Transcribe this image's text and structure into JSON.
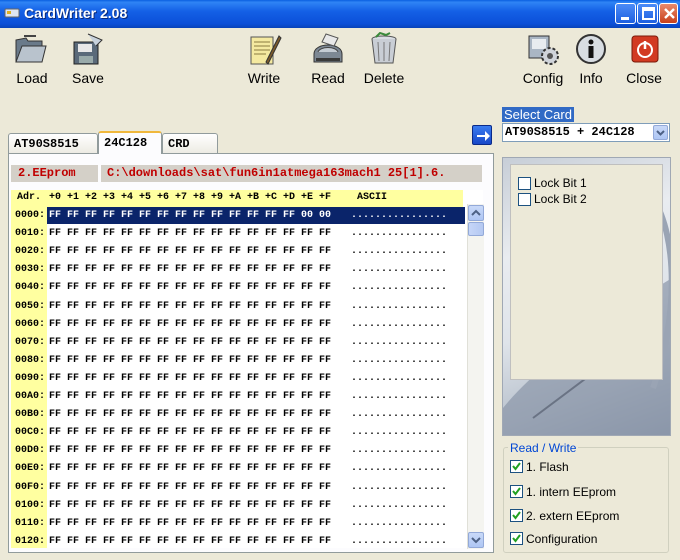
{
  "window": {
    "title": "CardWriter 2.08"
  },
  "toolbar": {
    "load": "Load",
    "save": "Save",
    "write": "Write",
    "read": "Read",
    "delete": "Delete",
    "config": "Config",
    "info": "Info",
    "close": "Close"
  },
  "tabs": [
    {
      "label": "AT90S8515"
    },
    {
      "label": "24C128"
    },
    {
      "label": "CRD"
    }
  ],
  "editor": {
    "section_label": "2.EEprom",
    "file_path": "C:\\downloads\\sat\\fun6in1atmega163mach1 25[1].6.",
    "header_addr": "Adr.",
    "header_cols": "+0 +1 +2 +3 +4 +5 +6 +7 +8 +9 +A +B +C +D +E +F",
    "header_ascii": "ASCII",
    "rows": [
      {
        "addr": "0000:",
        "bytes": "FF FF FF FF FF FF FF FF FF FF FF FF FF FF 00 00",
        "ascii": "................"
      },
      {
        "addr": "0010:",
        "bytes": "FF FF FF FF FF FF FF FF FF FF FF FF FF FF FF FF",
        "ascii": "................"
      },
      {
        "addr": "0020:",
        "bytes": "FF FF FF FF FF FF FF FF FF FF FF FF FF FF FF FF",
        "ascii": "................"
      },
      {
        "addr": "0030:",
        "bytes": "FF FF FF FF FF FF FF FF FF FF FF FF FF FF FF FF",
        "ascii": "................"
      },
      {
        "addr": "0040:",
        "bytes": "FF FF FF FF FF FF FF FF FF FF FF FF FF FF FF FF",
        "ascii": "................"
      },
      {
        "addr": "0050:",
        "bytes": "FF FF FF FF FF FF FF FF FF FF FF FF FF FF FF FF",
        "ascii": "................"
      },
      {
        "addr": "0060:",
        "bytes": "FF FF FF FF FF FF FF FF FF FF FF FF FF FF FF FF",
        "ascii": "................"
      },
      {
        "addr": "0070:",
        "bytes": "FF FF FF FF FF FF FF FF FF FF FF FF FF FF FF FF",
        "ascii": "................"
      },
      {
        "addr": "0080:",
        "bytes": "FF FF FF FF FF FF FF FF FF FF FF FF FF FF FF FF",
        "ascii": "................"
      },
      {
        "addr": "0090:",
        "bytes": "FF FF FF FF FF FF FF FF FF FF FF FF FF FF FF FF",
        "ascii": "................"
      },
      {
        "addr": "00A0:",
        "bytes": "FF FF FF FF FF FF FF FF FF FF FF FF FF FF FF FF",
        "ascii": "................"
      },
      {
        "addr": "00B0:",
        "bytes": "FF FF FF FF FF FF FF FF FF FF FF FF FF FF FF FF",
        "ascii": "................"
      },
      {
        "addr": "00C0:",
        "bytes": "FF FF FF FF FF FF FF FF FF FF FF FF FF FF FF FF",
        "ascii": "................"
      },
      {
        "addr": "00D0:",
        "bytes": "FF FF FF FF FF FF FF FF FF FF FF FF FF FF FF FF",
        "ascii": "................"
      },
      {
        "addr": "00E0:",
        "bytes": "FF FF FF FF FF FF FF FF FF FF FF FF FF FF FF FF",
        "ascii": "................"
      },
      {
        "addr": "00F0:",
        "bytes": "FF FF FF FF FF FF FF FF FF FF FF FF FF FF FF FF",
        "ascii": "................"
      },
      {
        "addr": "0100:",
        "bytes": "FF FF FF FF FF FF FF FF FF FF FF FF FF FF FF FF",
        "ascii": "................"
      },
      {
        "addr": "0110:",
        "bytes": "FF FF FF FF FF FF FF FF FF FF FF FF FF FF FF FF",
        "ascii": "................"
      },
      {
        "addr": "0120:",
        "bytes": "FF FF FF FF FF FF FF FF FF FF FF FF FF FF FF FF",
        "ascii": "................"
      }
    ]
  },
  "card": {
    "select_label": "Select Card",
    "selected": "AT90S8515 + 24C128",
    "lock_bit_1": "Lock Bit 1",
    "lock_bit_2": "Lock Bit 2"
  },
  "read_write": {
    "title": "Read / Write",
    "flash": "1. Flash",
    "intern_eeprom": "1. intern EEprom",
    "extern_eeprom": "2. extern EEprom",
    "configuration": "Configuration"
  },
  "colors": {
    "selection": "#0a246a",
    "header_yellow": "#ffffa0",
    "label_red": "#c00000",
    "title_blue": "#0b4fd8"
  },
  "icons": {
    "load": "folder-open-icon",
    "save": "floppy-save-icon",
    "write": "pen-notepad-icon",
    "read": "card-reader-icon",
    "delete": "trash-icon",
    "config": "gear-icon",
    "info": "info-icon",
    "close": "power-icon"
  }
}
